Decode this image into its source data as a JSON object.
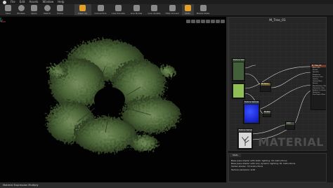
{
  "menu": {
    "items": [
      "File",
      "Edit",
      "Assets",
      "Window",
      "Help"
    ]
  },
  "toolbar": {
    "buttons": [
      {
        "label": "Save",
        "icon": "save-icon"
      },
      {
        "label": "Browse",
        "icon": "browse-icon"
      },
      {
        "label": "Apply",
        "icon": "apply-icon"
      },
      {
        "label": "Search",
        "icon": "search-icon"
      },
      {
        "label": "Home",
        "icon": "home-icon"
      },
      {
        "label": "Clean Up",
        "icon": "clean-up-icon"
      },
      {
        "label": "Connectors",
        "icon": "connectors-icon"
      },
      {
        "label": "Live Preview",
        "icon": "live-preview-icon"
      },
      {
        "label": "Live Nodes",
        "icon": "live-nodes-icon"
      },
      {
        "label": "Live Update",
        "icon": "live-update-icon"
      },
      {
        "label": "Hide Unused",
        "icon": "hide-unused-icon"
      },
      {
        "label": "Stats",
        "icon": "stats-icon"
      },
      {
        "label": "Mobile Stats",
        "icon": "mobile-stats-icon"
      }
    ]
  },
  "graph": {
    "title": "M_Tree_01",
    "watermark": "MATERIAL",
    "nodes": {
      "color_param": "Texture Sample",
      "main_node": "M_Tree_01",
      "normal_param": "Texture Sample",
      "mask_param": "Texture Sample",
      "small_node": "Multiply",
      "lerp_node": "Lerp",
      "mult_node": "Multiply"
    },
    "main_pins": [
      "Base Color",
      "Metallic",
      "Specular",
      "Roughness",
      "Emissive Color",
      "Opacity",
      "Opacity Mask",
      "Normal",
      "World Position Offset",
      "Subsurface Color",
      "Ambient Occlusion",
      "Refraction",
      "Pixel Depth Offset"
    ]
  },
  "stats": {
    "tab_label": "Stats",
    "lines": [
      "Base pass shader with static lighting: 94 instructions",
      "Base pass shader with only dynamic lighting: 81 instructions",
      "Vertex shader: 33 instructions",
      "Texture samplers: 4/16"
    ]
  },
  "status": {
    "text": "Material Expression Multiply"
  },
  "colors": {
    "accent": "#e4a12a",
    "foliage": "#4f6a3a",
    "normal_preview": "#1d2bd6",
    "color_preview": "#8fbf55"
  }
}
